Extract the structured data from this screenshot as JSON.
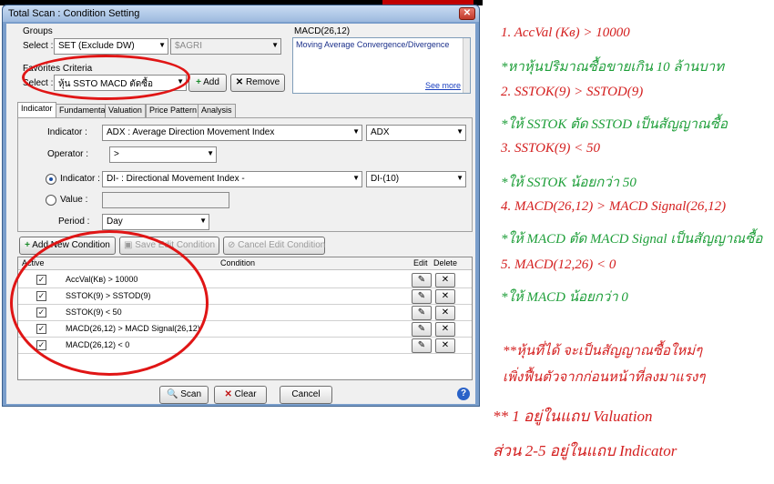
{
  "window": {
    "title": "Total Scan : Condition Setting",
    "close_glyph": "✕"
  },
  "groups": {
    "label": "Groups",
    "select_label": "Select :",
    "selected": "SET (Exclude DW)",
    "second": "$AGRI"
  },
  "favorites": {
    "label": "Favorites Criteria",
    "select_label": "Select :",
    "selected": "หุ้น SSTO MACD ตัดซื้อ",
    "add": "Add",
    "remove": "Remove"
  },
  "description": {
    "title": "MACD(26,12)",
    "text": "Moving Average Convergence/Divergence",
    "see_more": "See more"
  },
  "tabs": [
    "Indicator",
    "Fundamental",
    "Valuation",
    "Price Pattern",
    "Analysis"
  ],
  "indicator_form": {
    "indicator_label": "Indicator :",
    "indicator_value": "ADX : Average Direction Movement Index",
    "indicator_param": "ADX",
    "operator_label": "Operator :",
    "operator_value": ">",
    "rhs_indicator_label": "Indicator :",
    "rhs_indicator_value": "DI- : Directional Movement Index -",
    "rhs_indicator_param": "DI-(10)",
    "value_label": "Value :",
    "period_label": "Period :",
    "period_value": "Day"
  },
  "condition_buttons": {
    "add": "Add New Condition",
    "save": "Save Edit Condition",
    "cancel": "Cancel Edit Condition"
  },
  "grid": {
    "headers": {
      "active": "Active",
      "condition": "Condition",
      "edit": "Edit",
      "delete": "Delete"
    },
    "rows": [
      {
        "active": true,
        "condition": "AccVal(Kв) > 10000"
      },
      {
        "active": true,
        "condition": "SSTOK(9) > SSTOD(9)"
      },
      {
        "active": true,
        "condition": "SSTOK(9) < 50"
      },
      {
        "active": true,
        "condition": "MACD(26,12) > MACD Signal(26,12)"
      },
      {
        "active": true,
        "condition": "MACD(26,12) < 0"
      }
    ]
  },
  "bottom_buttons": {
    "scan": "Scan",
    "clear": "Clear",
    "cancel": "Cancel"
  },
  "notes": [
    {
      "text": "1. AccVal (Kв) > 10000",
      "color": "#d42020"
    },
    {
      "text": "*หาหุ้นปริมาณซื้อขายเกิน 10 ล้านบาท",
      "color": "#1f9f3a"
    },
    {
      "text": "2. SSTOK(9) > SSTOD(9)",
      "color": "#d42020"
    },
    {
      "text": "*ให้ SSTOK ตัด SSTOD เป็นสัญญาณซื้อ",
      "color": "#1f9f3a"
    },
    {
      "text": "3. SSTOK(9) < 50",
      "color": "#d42020"
    },
    {
      "text": "*ให้ SSTOK น้อยกว่า 50",
      "color": "#1f9f3a"
    },
    {
      "text": "4. MACD(26,12) > MACD Signal(26,12)",
      "color": "#d42020"
    },
    {
      "text": "*ให้ MACD ตัด MACD Signal เป็นสัญญาณซื้อ",
      "color": "#1f9f3a"
    },
    {
      "text": "5. MACD(12,26) < 0",
      "color": "#d42020"
    },
    {
      "text": "*ให้ MACD น้อยกว่า 0",
      "color": "#1f9f3a"
    }
  ],
  "summary_notes": [
    "**หุ้นที่ได้ จะเป็นสัญญาณซื้อใหม่ๆ",
    "เพิ่งฟื้นตัวจากก่อนหน้าที่ลงมาแรงๆ",
    "** 1 อยู่ในแถบ Valuation",
    "ส่วน 2-5 อยู่ในแถบ Indicator"
  ]
}
